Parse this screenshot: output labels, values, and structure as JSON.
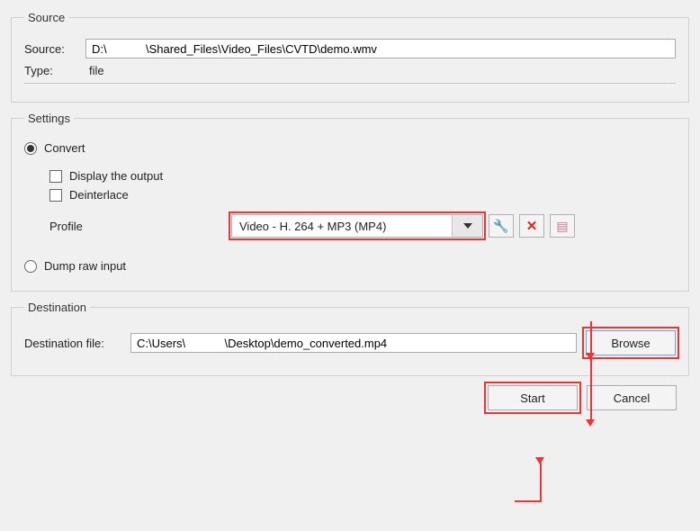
{
  "source_group": {
    "legend": "Source",
    "source_label": "Source:",
    "source_value": "D:\\            \\Shared_Files\\Video_Files\\CVTD\\demo.wmv",
    "type_label": "Type:",
    "type_value": "file"
  },
  "settings_group": {
    "legend": "Settings",
    "convert_label": "Convert",
    "display_output_label": "Display the output",
    "deinterlace_label": "Deinterlace",
    "profile_label": "Profile",
    "profile_value": "Video - H. 264 + MP3 (MP4)",
    "dump_raw_label": "Dump raw input"
  },
  "destination_group": {
    "legend": "Destination",
    "dest_file_label": "Destination file:",
    "dest_file_value": "C:\\Users\\            \\Desktop\\demo_converted.mp4",
    "browse_label": "Browse"
  },
  "buttons": {
    "start": "Start",
    "cancel": "Cancel"
  }
}
